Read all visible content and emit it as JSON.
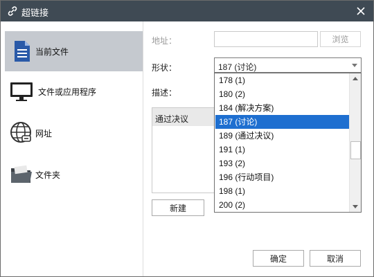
{
  "window": {
    "title": "超链接",
    "accent": "#1e6fd0",
    "titlebar_color": "#3f4a54"
  },
  "sidebar": {
    "items": [
      {
        "label": "当前文件",
        "icon": "document-icon",
        "selected": true
      },
      {
        "label": "文件或应用程序",
        "icon": "monitor-icon",
        "selected": false
      },
      {
        "label": "网址",
        "icon": "globe-icon",
        "selected": false
      },
      {
        "label": "文件夹",
        "icon": "folder-icon",
        "selected": false
      }
    ]
  },
  "form": {
    "address_label": "地址：",
    "address_value": "",
    "browse_label": "浏览",
    "shape_label": "形状：",
    "shape_value": "187 (讨论)",
    "desc_label": "描述：",
    "desc_value": "通过决议",
    "new_label": "新建"
  },
  "dropdown": {
    "options": [
      "178 (1)",
      "180 (2)",
      "184 (解决方案)",
      "187 (讨论)",
      "189 (通过决议)",
      "191 (1)",
      "193 (2)",
      "196 (行动项目)",
      "198 (1)",
      "200 (2)"
    ],
    "selected_index": 3
  },
  "footer": {
    "ok_label": "确定",
    "cancel_label": "取消"
  }
}
